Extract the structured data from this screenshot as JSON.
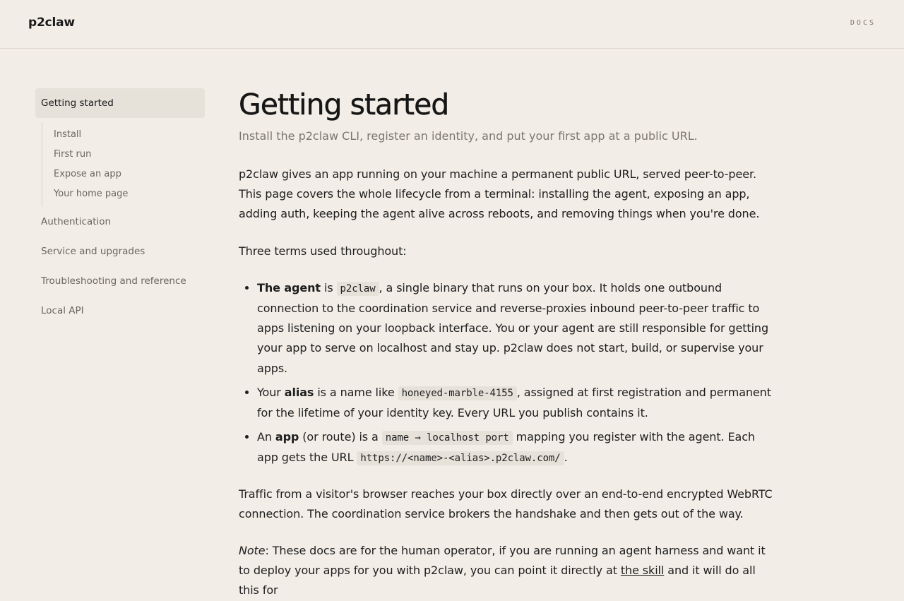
{
  "header": {
    "brand": "p2claw",
    "docs_link": "DOCS"
  },
  "sidebar": {
    "active": "Getting started",
    "sub_items": [
      "Install",
      "First run",
      "Expose an app",
      "Your home page"
    ],
    "items": [
      "Authentication",
      "Service and upgrades",
      "Troubleshooting and reference",
      "Local API"
    ]
  },
  "main": {
    "title": "Getting started",
    "subtitle": "Install the p2claw CLI, register an identity, and put your first app at a public URL.",
    "intro": "p2claw gives an app running on your machine a permanent public URL, served peer-to-peer. This page covers the whole lifecycle from a terminal: installing the agent, exposing an app, adding auth, keeping the agent alive across reboots, and removing things when you're done.",
    "terms_lead": "Three terms used throughout:",
    "terms": {
      "agent": {
        "pre": "The ",
        "term": "agent",
        "mid": " is ",
        "code": "p2claw",
        "post": ", a single binary that runs on your box. It holds one outbound connection to the coordination service and reverse-proxies inbound peer-to-peer traffic to apps listening on your loopback interface. You or your agent are still responsible for getting your app to serve on localhost and stay up. p2claw does not start, build, or supervise your apps."
      },
      "alias": {
        "pre": "Your ",
        "term": "alias",
        "mid": " is a name like ",
        "code": "honeyed-marble-4155",
        "post": ", assigned at first registration and permanent for the lifetime of your identity key. Every URL you publish contains it."
      },
      "app": {
        "pre": "An ",
        "term": "app",
        "mid": " (or route) is a ",
        "code": "name → localhost port",
        "mid2": " mapping you register with the agent. Each app gets the URL ",
        "code2": "https://<name>-<alias>.p2claw.com/",
        "post": "."
      }
    },
    "traffic": "Traffic from a visitor's browser reaches your box directly over an end-to-end encrypted WebRTC connection. The coordination service brokers the handshake and then gets out of the way.",
    "note": {
      "label": "Note",
      "pre": ": These docs are for the human operator, if you are running an agent harness and want it to deploy your apps for you with p2claw, you can point it directly at ",
      "link": "the skill",
      "post": " and it will do all this for"
    }
  }
}
